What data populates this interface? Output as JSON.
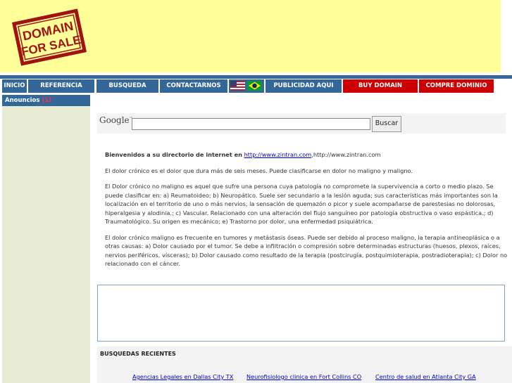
{
  "header": {
    "stamp_text_line1": "DOMAIN",
    "stamp_text_line2": "FOR SALE"
  },
  "nav": {
    "items": [
      {
        "label": "INICIO"
      },
      {
        "label": "REFERENCIA"
      },
      {
        "label": "BUSQUEDA"
      },
      {
        "label": "CONTACTARNOS"
      },
      {
        "label": "PUBLICIDAD AQUI"
      },
      {
        "label": "BUY DOMAIN"
      },
      {
        "label": "COMPRE DOMINIO"
      }
    ],
    "flags": [
      "us-flag-icon",
      "brazil-flag-icon"
    ],
    "colors": {
      "blue": "#336699",
      "red": "#cc0000"
    }
  },
  "sidebar": {
    "heading": "Anouncios",
    "count": "(1)"
  },
  "search": {
    "logo": "Google",
    "logo_tm": "™",
    "input_value": "",
    "button_label": "Buscar"
  },
  "content": {
    "welcome_prefix": "Bienvenidos a su directorio de internet en",
    "welcome_link": "http://www.zintran.com",
    "welcome_suffix": ",http://www.zintran.com",
    "p1": "El dolor crónico es el dolor que dura más de seis meses. Puede clasificarse en dolor no maligno y maligno.",
    "p2": "El Dolor crónico no maligno es aquel que sufre una persona cuya patología no compromete la supervivencia a corto o medio plazo. Se puede clasificar en: a) Reumatoideo; b) Neuropático. Suele ser secundario a la lesión aguda; sus características más importantes son la localización en el territorio de uno o más nervios, la sensación de quemazón o picor y suele acompañarse de parestesias no dolorosas, hiperalgesia y alodinia.; c) Vascular. Relacionado con una alteración del flujo sanguíneo por patología obstructiva o vaso espástica.; d) Traumatológico. Su origen es mecánico; e) Trastorno por dolor, una enfermedad psiquiátrica.",
    "p3": "El dolor crónico maligno es frecuente en tumores y metástasis óseas. Puede ser debido al proceso maligno, la terapia antineoplásica o a otras causas:  a) Dolor causado por el tumor. Se debe a infiltración o compresión sobre determinadas estructuras (huesos, plexos, raíces, nervios periféricos, vísceras); b) Dolor causado como resultado de la terapia (postcirugía, postquimioterapia, postradioterapia); c) Dolor no relacionado con el cáncer."
  },
  "recent": {
    "title": "BUSQUEDAS RECIENTES",
    "links": [
      "Agencias Legales en Dallas City TX",
      "Neurofisiologo clinica en Fort Collins CO",
      "Centro de salud en Atlanta City GA"
    ]
  }
}
